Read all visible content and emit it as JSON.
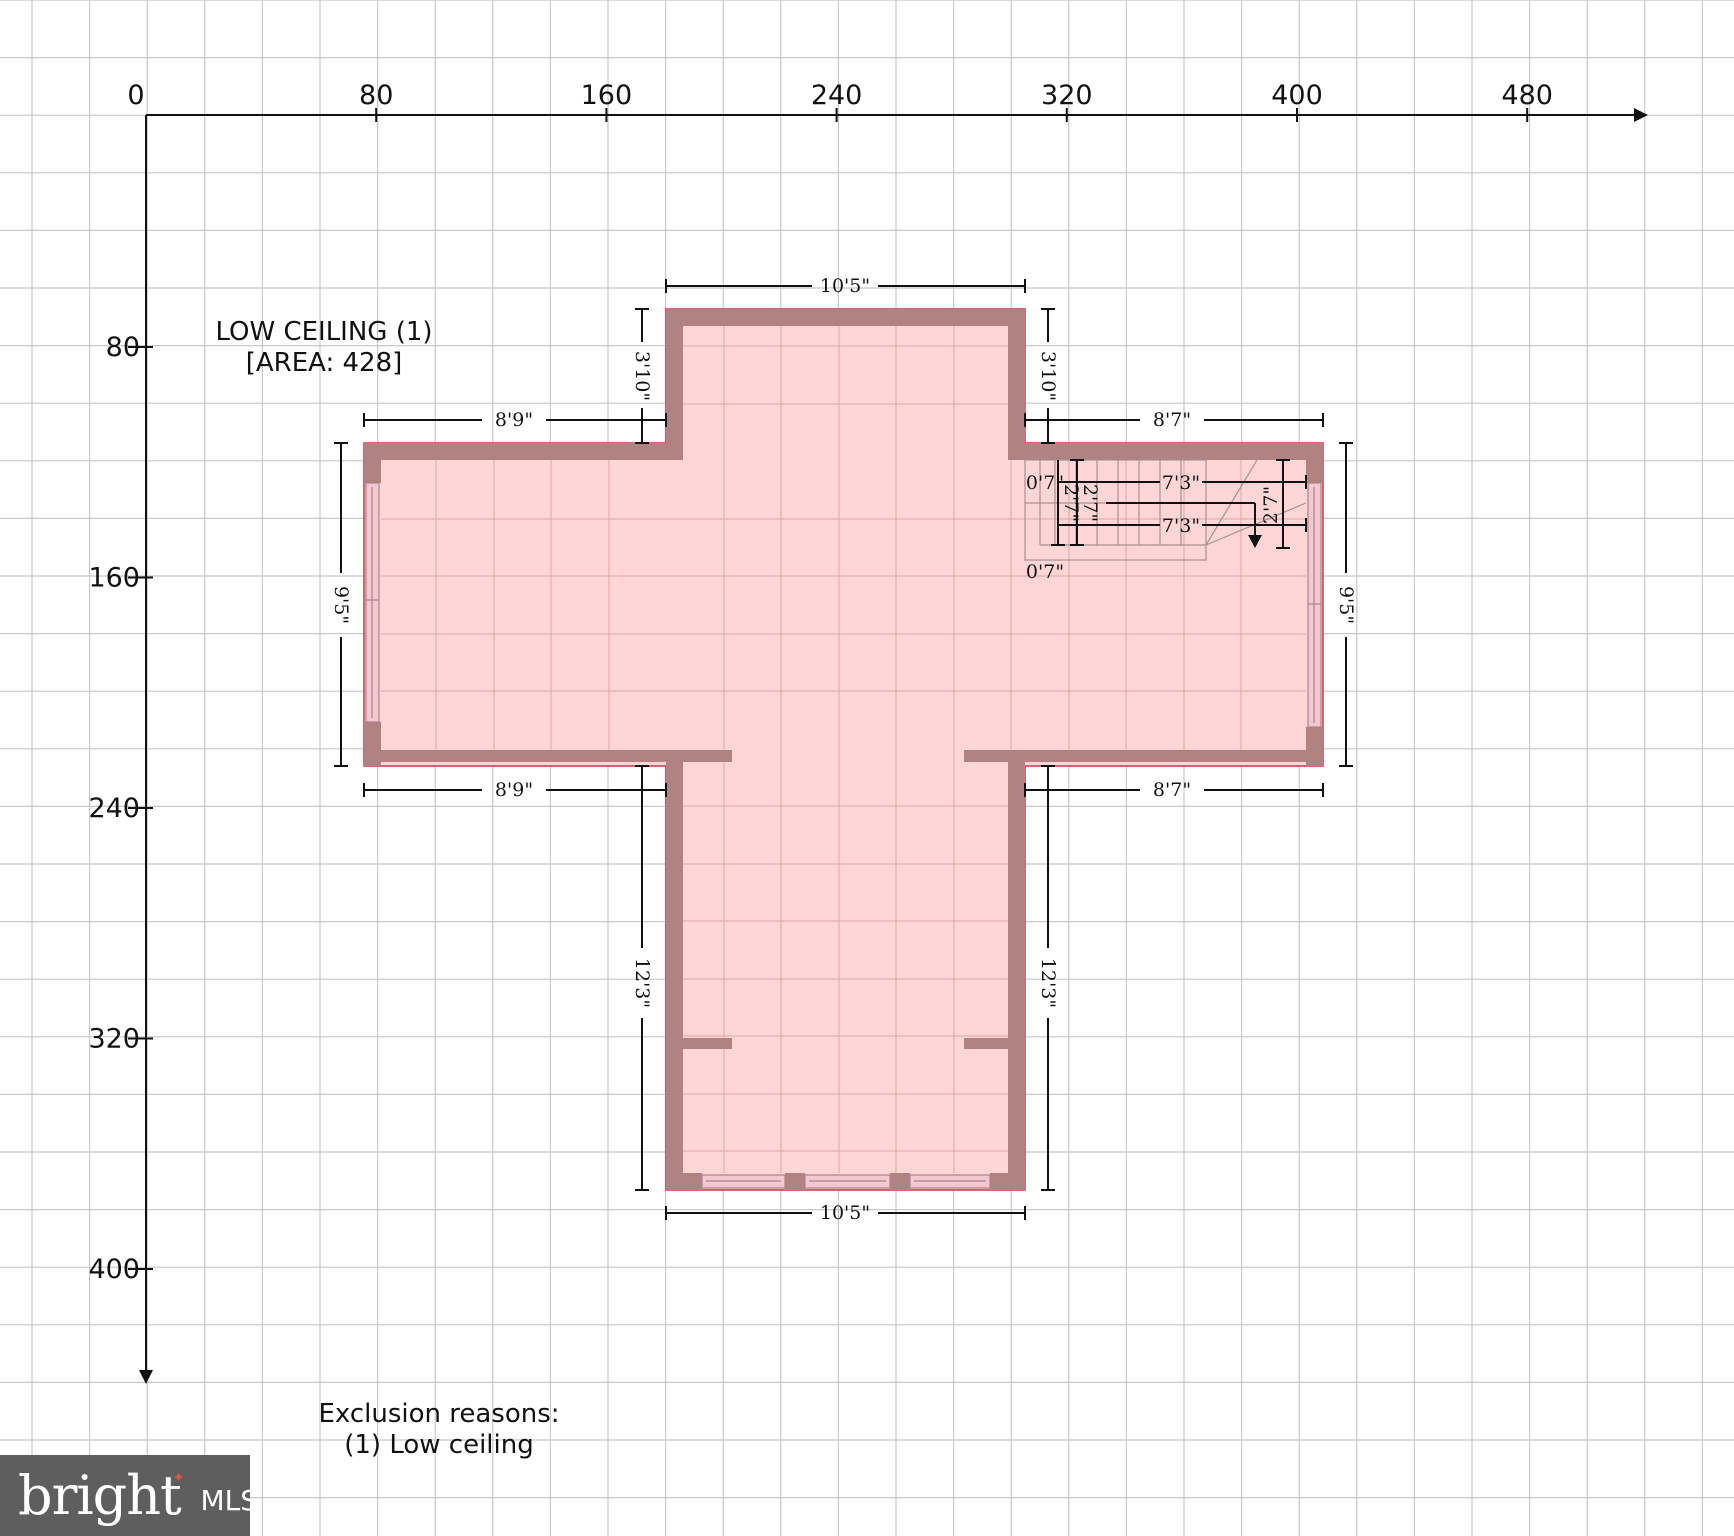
{
  "axes": {
    "x_ticks": [
      "0",
      "80",
      "160",
      "240",
      "320",
      "400",
      "480"
    ],
    "y_ticks": [
      "80",
      "160",
      "240",
      "320",
      "400"
    ]
  },
  "room": {
    "name": "LOW CEILING (1)",
    "area": "[AREA: 428]"
  },
  "dimensions": {
    "top_width": "10'5\"",
    "bottom_width": "10'5\"",
    "upper_left_height": "3'10\"",
    "upper_right_height": "3'10\"",
    "left_top": "8'9\"",
    "left_bottom": "8'9\"",
    "right_top": "8'7\"",
    "right_bottom": "8'7\"",
    "left_side": "9'5\"",
    "right_side": "9'5\"",
    "lower_left_height": "12'3\"",
    "lower_right_height": "12'3\"",
    "stair_offset_top": "0'7\"",
    "stair_offset_bottom": "0'7\"",
    "stair_run_1": "7'3\"",
    "stair_run_2": "7'3\"",
    "stair_width_a": "2'7\"",
    "stair_width_b": "2'7\"",
    "stair_width_c": "2'7\""
  },
  "notes": {
    "exclusion_title": "Exclusion reasons:",
    "exclusion_item": "(1) Low ceiling"
  },
  "logo": {
    "word": "bright",
    "suffix": "MLS"
  },
  "colors": {
    "floor": "#ffd6d6",
    "wall": "#b08282",
    "grid": "#c8c8c8"
  }
}
